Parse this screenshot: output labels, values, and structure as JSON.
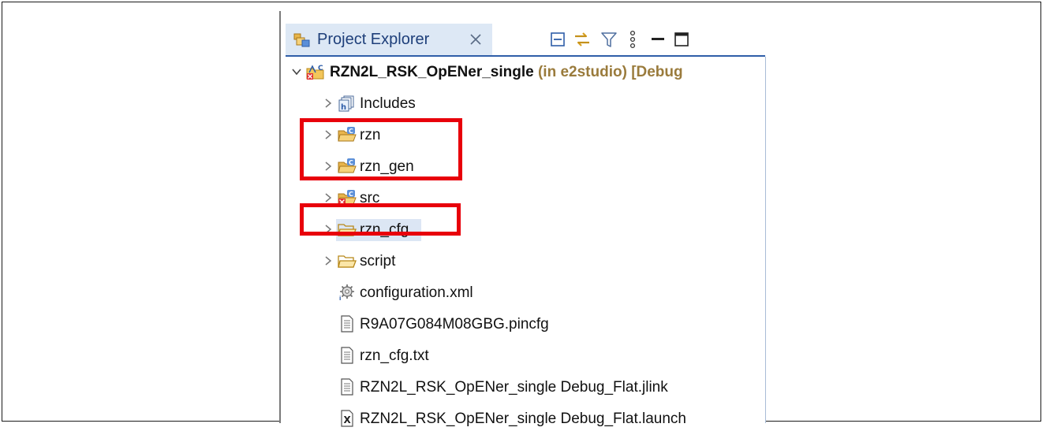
{
  "explorer": {
    "tab_label": "Project Explorer",
    "icons": {
      "tab": "project-explorer-icon",
      "close": "close-icon",
      "collapse_all": "collapse-all-icon",
      "link_editor": "link-with-editor-icon",
      "filter": "filter-icon",
      "view_menu": "view-menu-icon",
      "minimize": "minimize-icon",
      "maximize": "maximize-icon"
    }
  },
  "tree": {
    "project": {
      "name": "RZN2L_RSK_OpENer_single",
      "decoration": " (in e2studio) [Debug"
    },
    "items": [
      {
        "label": "Includes",
        "icon": "includes-icon",
        "expandable": true
      },
      {
        "label": "rzn",
        "icon": "source-folder-icon",
        "expandable": true
      },
      {
        "label": "rzn_gen",
        "icon": "source-folder-icon",
        "expandable": true
      },
      {
        "label": "src",
        "icon": "source-folder-error-icon",
        "expandable": true
      },
      {
        "label": "rzn_cfg",
        "icon": "folder-icon",
        "expandable": true,
        "selected": true
      },
      {
        "label": "script",
        "icon": "folder-icon",
        "expandable": true
      },
      {
        "label": "configuration.xml",
        "icon": "configuration-icon",
        "expandable": false
      },
      {
        "label": "R9A07G084M08GBG.pincfg",
        "icon": "file-icon",
        "expandable": false
      },
      {
        "label": "rzn_cfg.txt",
        "icon": "file-icon",
        "expandable": false
      },
      {
        "label": "RZN2L_RSK_OpENer_single Debug_Flat.jlink",
        "icon": "file-icon",
        "expandable": false
      },
      {
        "label": "RZN2L_RSK_OpENer_single Debug_Flat.launch",
        "icon": "launch-file-icon",
        "expandable": false
      }
    ]
  },
  "colors": {
    "highlight": "#e8000b",
    "selection": "#dce6f4",
    "tab_background": "#dde8f5",
    "decoration_text": "#9a7b3c"
  }
}
